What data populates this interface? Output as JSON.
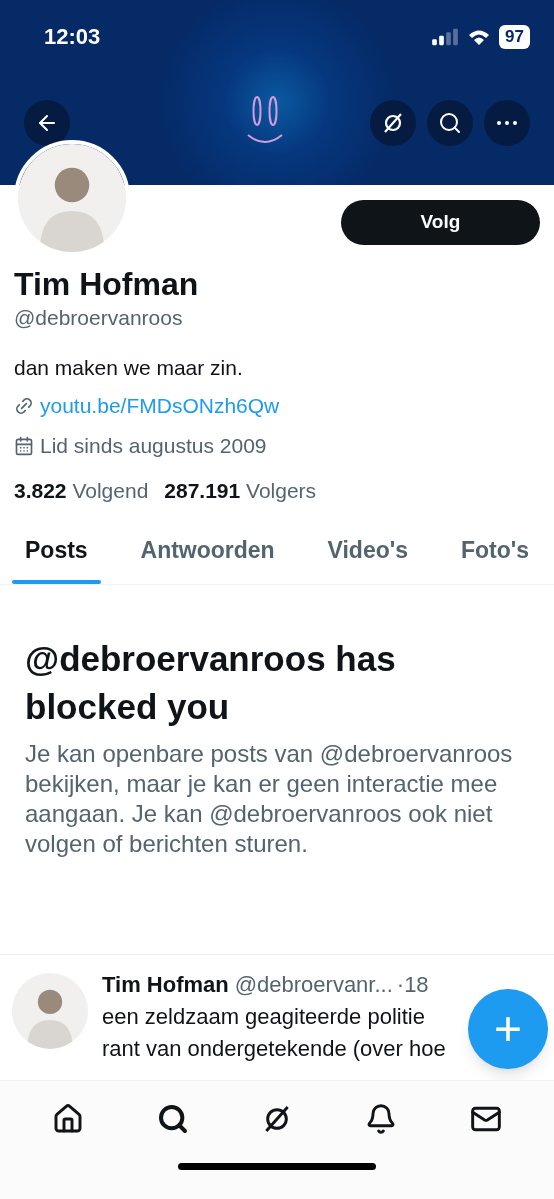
{
  "status_bar": {
    "time": "12:03",
    "battery": "97"
  },
  "profile": {
    "name": "Tim Hofman",
    "handle": "@debroervanroos",
    "bio": "dan maken we maar zin.",
    "link": "youtu.be/FMDsONzh6Qw",
    "joined": "Lid sinds augustus 2009",
    "follow_button": "Volg"
  },
  "stats": [
    "**3.822** Volgend",
    "**287.191** Volgers"
  ],
  "tabs": [
    {
      "label": "Posts",
      "selected": true
    },
    {
      "label": "Antwoorden",
      "selected": false
    },
    {
      "label": "Video's",
      "selected": false
    },
    {
      "label": "Foto's",
      "selected": false
    }
  ],
  "blocked_notice": {
    "title": "@debroervanroos has blocked you",
    "body": "Je kan openbare posts van @debroervanroos bekijken, maar je kan er geen interactie mee aangaan. Je kan @debroervanroos ook niet volgen of berichten sturen."
  },
  "post": {
    "name": "Tim Hofman",
    "handle": "@debroervanr...",
    "time": "·18",
    "lines": [
      "een zeldzaam geagiteerde politie",
      "rant van ondergetekende (over hoe"
    ]
  },
  "fab": {
    "label": "+"
  },
  "bottom_nav": [
    {
      "kind": "home"
    },
    {
      "kind": "search"
    },
    {
      "kind": "grok"
    },
    {
      "kind": "bell"
    },
    {
      "kind": "mail"
    }
  ]
}
